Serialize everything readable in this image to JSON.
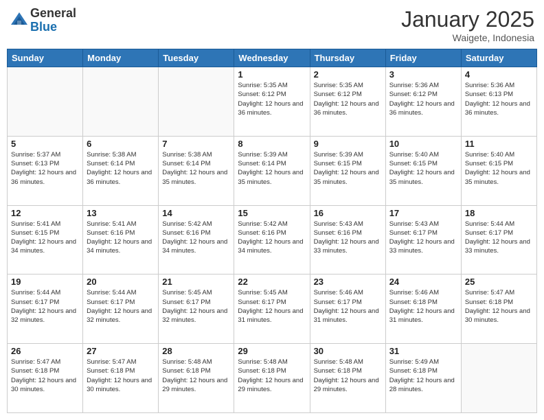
{
  "header": {
    "logo_general": "General",
    "logo_blue": "Blue",
    "month_title": "January 2025",
    "location": "Waigete, Indonesia"
  },
  "days_of_week": [
    "Sunday",
    "Monday",
    "Tuesday",
    "Wednesday",
    "Thursday",
    "Friday",
    "Saturday"
  ],
  "weeks": [
    [
      {
        "day": "",
        "info": ""
      },
      {
        "day": "",
        "info": ""
      },
      {
        "day": "",
        "info": ""
      },
      {
        "day": "1",
        "info": "Sunrise: 5:35 AM\nSunset: 6:12 PM\nDaylight: 12 hours and 36 minutes."
      },
      {
        "day": "2",
        "info": "Sunrise: 5:35 AM\nSunset: 6:12 PM\nDaylight: 12 hours and 36 minutes."
      },
      {
        "day": "3",
        "info": "Sunrise: 5:36 AM\nSunset: 6:12 PM\nDaylight: 12 hours and 36 minutes."
      },
      {
        "day": "4",
        "info": "Sunrise: 5:36 AM\nSunset: 6:13 PM\nDaylight: 12 hours and 36 minutes."
      }
    ],
    [
      {
        "day": "5",
        "info": "Sunrise: 5:37 AM\nSunset: 6:13 PM\nDaylight: 12 hours and 36 minutes."
      },
      {
        "day": "6",
        "info": "Sunrise: 5:38 AM\nSunset: 6:14 PM\nDaylight: 12 hours and 36 minutes."
      },
      {
        "day": "7",
        "info": "Sunrise: 5:38 AM\nSunset: 6:14 PM\nDaylight: 12 hours and 35 minutes."
      },
      {
        "day": "8",
        "info": "Sunrise: 5:39 AM\nSunset: 6:14 PM\nDaylight: 12 hours and 35 minutes."
      },
      {
        "day": "9",
        "info": "Sunrise: 5:39 AM\nSunset: 6:15 PM\nDaylight: 12 hours and 35 minutes."
      },
      {
        "day": "10",
        "info": "Sunrise: 5:40 AM\nSunset: 6:15 PM\nDaylight: 12 hours and 35 minutes."
      },
      {
        "day": "11",
        "info": "Sunrise: 5:40 AM\nSunset: 6:15 PM\nDaylight: 12 hours and 35 minutes."
      }
    ],
    [
      {
        "day": "12",
        "info": "Sunrise: 5:41 AM\nSunset: 6:15 PM\nDaylight: 12 hours and 34 minutes."
      },
      {
        "day": "13",
        "info": "Sunrise: 5:41 AM\nSunset: 6:16 PM\nDaylight: 12 hours and 34 minutes."
      },
      {
        "day": "14",
        "info": "Sunrise: 5:42 AM\nSunset: 6:16 PM\nDaylight: 12 hours and 34 minutes."
      },
      {
        "day": "15",
        "info": "Sunrise: 5:42 AM\nSunset: 6:16 PM\nDaylight: 12 hours and 34 minutes."
      },
      {
        "day": "16",
        "info": "Sunrise: 5:43 AM\nSunset: 6:16 PM\nDaylight: 12 hours and 33 minutes."
      },
      {
        "day": "17",
        "info": "Sunrise: 5:43 AM\nSunset: 6:17 PM\nDaylight: 12 hours and 33 minutes."
      },
      {
        "day": "18",
        "info": "Sunrise: 5:44 AM\nSunset: 6:17 PM\nDaylight: 12 hours and 33 minutes."
      }
    ],
    [
      {
        "day": "19",
        "info": "Sunrise: 5:44 AM\nSunset: 6:17 PM\nDaylight: 12 hours and 32 minutes."
      },
      {
        "day": "20",
        "info": "Sunrise: 5:44 AM\nSunset: 6:17 PM\nDaylight: 12 hours and 32 minutes."
      },
      {
        "day": "21",
        "info": "Sunrise: 5:45 AM\nSunset: 6:17 PM\nDaylight: 12 hours and 32 minutes."
      },
      {
        "day": "22",
        "info": "Sunrise: 5:45 AM\nSunset: 6:17 PM\nDaylight: 12 hours and 31 minutes."
      },
      {
        "day": "23",
        "info": "Sunrise: 5:46 AM\nSunset: 6:17 PM\nDaylight: 12 hours and 31 minutes."
      },
      {
        "day": "24",
        "info": "Sunrise: 5:46 AM\nSunset: 6:18 PM\nDaylight: 12 hours and 31 minutes."
      },
      {
        "day": "25",
        "info": "Sunrise: 5:47 AM\nSunset: 6:18 PM\nDaylight: 12 hours and 30 minutes."
      }
    ],
    [
      {
        "day": "26",
        "info": "Sunrise: 5:47 AM\nSunset: 6:18 PM\nDaylight: 12 hours and 30 minutes."
      },
      {
        "day": "27",
        "info": "Sunrise: 5:47 AM\nSunset: 6:18 PM\nDaylight: 12 hours and 30 minutes."
      },
      {
        "day": "28",
        "info": "Sunrise: 5:48 AM\nSunset: 6:18 PM\nDaylight: 12 hours and 29 minutes."
      },
      {
        "day": "29",
        "info": "Sunrise: 5:48 AM\nSunset: 6:18 PM\nDaylight: 12 hours and 29 minutes."
      },
      {
        "day": "30",
        "info": "Sunrise: 5:48 AM\nSunset: 6:18 PM\nDaylight: 12 hours and 29 minutes."
      },
      {
        "day": "31",
        "info": "Sunrise: 5:49 AM\nSunset: 6:18 PM\nDaylight: 12 hours and 28 minutes."
      },
      {
        "day": "",
        "info": ""
      }
    ]
  ]
}
